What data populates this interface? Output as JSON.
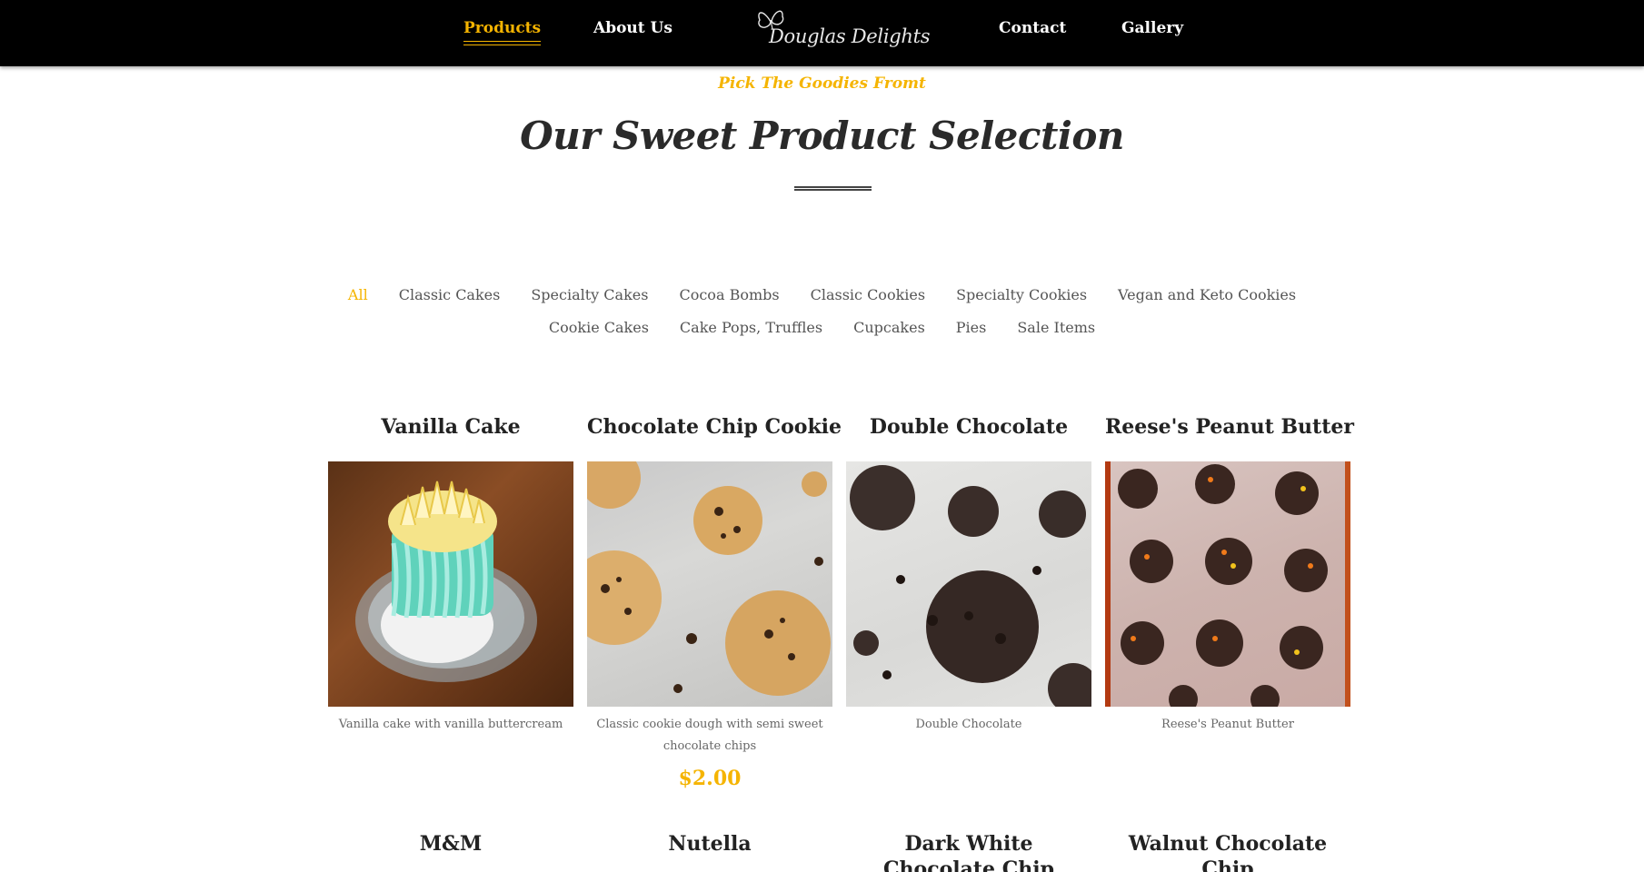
{
  "nav": {
    "products": "Products",
    "about": "About Us",
    "contact": "Contact",
    "gallery": "Gallery",
    "logo_text": "Douglas Delights"
  },
  "hero": {
    "kicker": "Pick The Goodies Fromt",
    "title": "Our Sweet Product Selection"
  },
  "filters": {
    "row1": [
      "All",
      "Classic Cakes",
      "Specialty Cakes",
      "Cocoa Bombs",
      "Classic Cookies",
      "Specialty Cookies",
      "Vegan and Keto Cookies"
    ],
    "row2": [
      "Cookie Cakes",
      "Cake Pops, Truffles",
      "Cupcakes",
      "Pies",
      "Sale Items"
    ],
    "active": "All"
  },
  "products": [
    {
      "title": "Vanilla Cake",
      "description": "Vanilla cake with vanilla buttercream",
      "price": ""
    },
    {
      "title": "Chocolate Chip Cookie",
      "description": "Classic cookie dough with semi sweet chocolate chips",
      "price": "$2.00"
    },
    {
      "title": "Double Chocolate",
      "description": "Double Chocolate",
      "price": ""
    },
    {
      "title": "Reese's Peanut Butter",
      "description": "Reese's Peanut Butter",
      "price": ""
    }
  ],
  "products_next_row": [
    {
      "title": "M&M"
    },
    {
      "title": "Nutella"
    },
    {
      "title": "Dark White Chocolate Chip"
    },
    {
      "title": "Walnut Chocolate Chip"
    }
  ],
  "colors": {
    "accent": "#f5b400",
    "header_bg": "#000000"
  }
}
